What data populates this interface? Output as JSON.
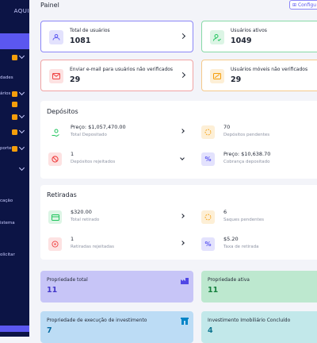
{
  "sidebar": {
    "brand": "AQUI",
    "items": [
      {
        "label": ""
      },
      {
        "label": "dades"
      },
      {
        "label": "ários"
      },
      {
        "label": ""
      },
      {
        "label": ""
      },
      {
        "label": "porte"
      },
      {
        "label": ""
      },
      {
        "label": "cação"
      },
      {
        "label": "istema"
      },
      {
        "label": "olicitar"
      }
    ]
  },
  "header": {
    "title": "Painel",
    "config_label": "Configu"
  },
  "stats": [
    {
      "label": "Total de usuários",
      "value": "1081",
      "color": "#5b57f0"
    },
    {
      "label": "Usuários ativos",
      "value": "1049",
      "color": "#22c55e"
    },
    {
      "label": "Enviar e-mail para usuários não verificados",
      "value": "29",
      "color": "#ef4444"
    },
    {
      "label": "Usuários móveis não verificados",
      "value": "29",
      "color": "#f59e0b"
    }
  ],
  "deposits": {
    "title": "Depósitos",
    "items": [
      {
        "primary": "Preço: $1,057,470.00",
        "secondary": "Total Depositado"
      },
      {
        "primary": "70",
        "secondary": "Depósitos pendentes"
      },
      {
        "primary": "1",
        "secondary": "Depósitos rejeitados"
      },
      {
        "primary": "Preço: $10,638.70",
        "secondary": "Cobrança depositado"
      }
    ]
  },
  "withdrawals": {
    "title": "Retiradas",
    "items": [
      {
        "primary": "$320.00",
        "secondary": "Total retirado"
      },
      {
        "primary": "6",
        "secondary": "Saques pendentes"
      },
      {
        "primary": "1",
        "secondary": "Retiradas rejeitadas"
      },
      {
        "primary": "$5.20",
        "secondary": "Taxa de retirada"
      }
    ]
  },
  "properties": [
    {
      "label": "Propriedade total",
      "value": "11",
      "bg": "#c7c5f7",
      "fg": "#4338ca"
    },
    {
      "label": "Propriedade ativa",
      "value": "11",
      "bg": "#bde8cf",
      "fg": "#15803d"
    },
    {
      "label": "Propriedade de execução de investimento",
      "value": "7",
      "bg": "#bcdcf5",
      "fg": "#0369a1"
    },
    {
      "label": "Investimento Imobiliário Concluído",
      "value": "4",
      "bg": "#c2e8ea",
      "fg": "#0e7490"
    }
  ]
}
